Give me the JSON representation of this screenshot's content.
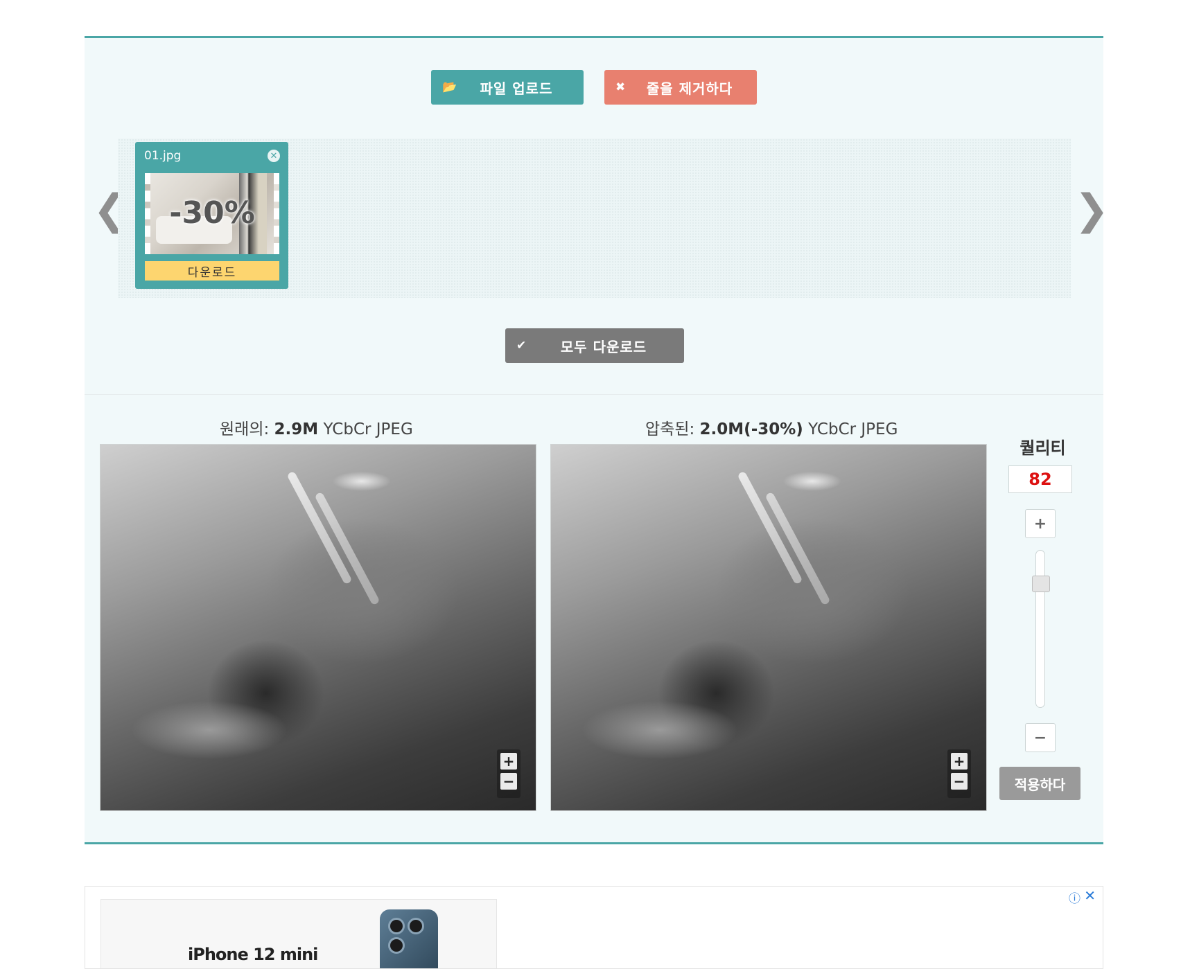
{
  "toolbar": {
    "upload_label": "파일 업로드",
    "clear_label": "줄을 제거하다",
    "download_all_label": "모두 다운로드"
  },
  "files": [
    {
      "name": "01.jpg",
      "badge": "-30%",
      "download_label": "다운로드"
    }
  ],
  "compare": {
    "original_prefix": "원래의:",
    "original_size": "2.9M",
    "original_format": "YCbCr JPEG",
    "compressed_prefix": "압축된:",
    "compressed_size": "2.0M(-30%)",
    "compressed_format": "YCbCr JPEG",
    "zoom_in": "+",
    "zoom_out": "−"
  },
  "quality": {
    "title": "퀄리티",
    "value": "82",
    "level": 0.82,
    "plus": "+",
    "minus": "−",
    "apply_label": "적용하다"
  },
  "ad": {
    "product": "iPhone 12 mini"
  },
  "colors": {
    "accent": "#4aa6a6",
    "danger": "#e8806f",
    "download_badge": "#fdd56f",
    "quality_value": "#dd1111"
  }
}
